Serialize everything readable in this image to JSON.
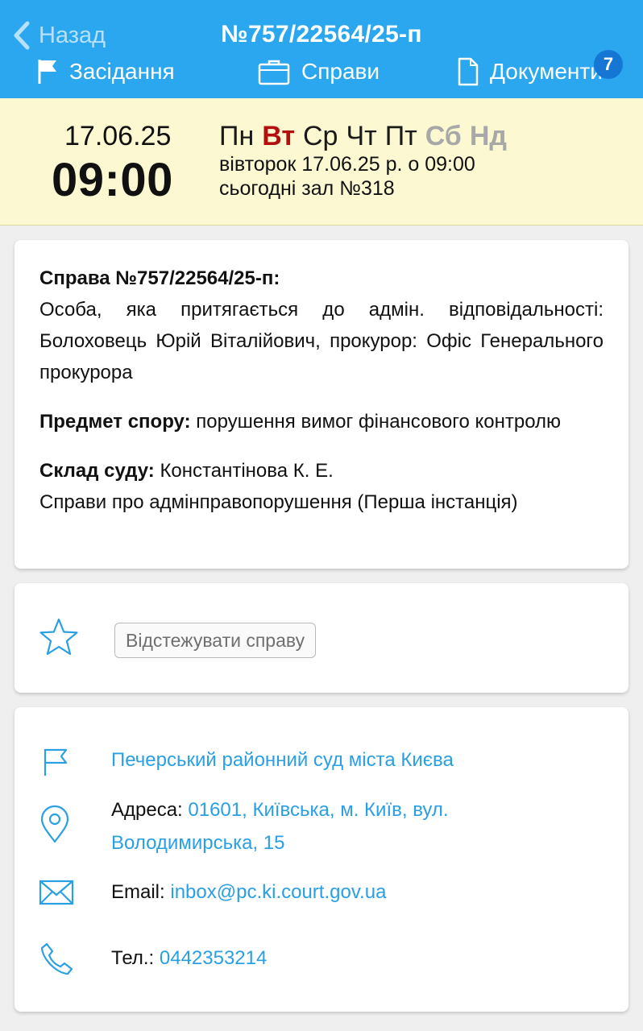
{
  "header": {
    "back_label": "Назад",
    "case_title": "№757/22564/25-п",
    "nav": {
      "meetings_label": "Засідання",
      "cases_label": "Справи",
      "documents_label": "Документи",
      "documents_badge": "7"
    }
  },
  "schedule": {
    "date_short": "17.06.25",
    "time": "09:00",
    "weekdays": [
      "Пн",
      "Вт",
      "Ср",
      "Чт",
      "Пт",
      "Сб",
      "Нд"
    ],
    "full_datetime": "вівторок 17.06.25 р. о 09:00",
    "room_text": "сьогодні зал №318"
  },
  "case": {
    "heading": "Справа №757/22564/25-п:",
    "parties_text": "Особа, яка притягається до адмін. відповідальності: Болоховець Юрій Віталійович, прокурор: Офіс Генерального прокурора",
    "subject_label": "Предмет спору:",
    "subject_value": " порушення вимог фінансового контролю",
    "court_composition_label": "Склад суду:",
    "court_composition_value": " Константінова К. Е.",
    "category": "Справи про адмінправопорушення (Перша інстанція)"
  },
  "follow": {
    "button_label": "Відстежувати справу"
  },
  "court": {
    "name": "Печерський районний суд міста Києва",
    "address_label": "Адреса: ",
    "address_line1": "01601, Київська, м. Київ, вул.",
    "address_line2": "Володимирська, 15",
    "email_label": "Email: ",
    "email": "inbox@pc.ki.court.gov.ua",
    "phone_label": "Тел.: ",
    "phone": "0442353214"
  },
  "colors": {
    "header_bg": "#2aa7ee",
    "date_band_bg": "#fbf8d2",
    "active_day": "#b30f0f",
    "weekend_day": "#a8a8a8",
    "link": "#2a9fe3",
    "badge": "#1576d4"
  },
  "icons": [
    "chevron-left-icon",
    "flag-icon",
    "briefcase-icon",
    "document-icon",
    "star-icon",
    "flag-outline-icon",
    "location-pin-icon",
    "envelope-icon",
    "phone-icon"
  ]
}
